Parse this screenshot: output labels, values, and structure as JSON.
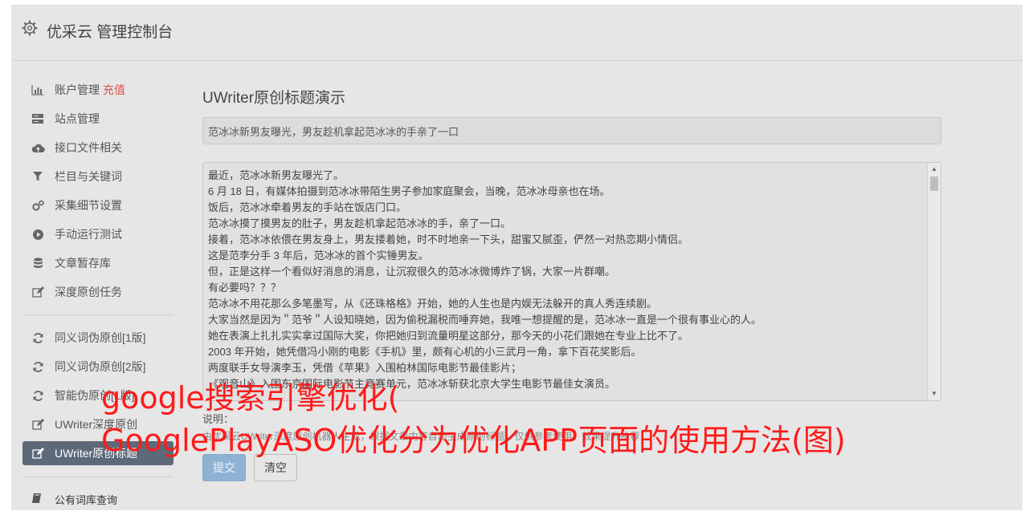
{
  "header": {
    "title": "优采云 管理控制台"
  },
  "sidebar": {
    "account": {
      "label": "账户管理",
      "recharge": "充值"
    },
    "group1": [
      {
        "label": "站点管理"
      },
      {
        "label": "接口文件相关"
      },
      {
        "label": "栏目与关键词"
      },
      {
        "label": "采集细节设置"
      },
      {
        "label": "手动运行测试"
      },
      {
        "label": "文章暂存库"
      },
      {
        "label": "深度原创任务"
      }
    ],
    "group2": [
      {
        "label": "同义词伪原创[1版]"
      },
      {
        "label": "同义词伪原创[2版]"
      },
      {
        "label": "智能伪原创[1版]"
      },
      {
        "label": "UWriter深度原创"
      },
      {
        "label": "UWriter原创标题"
      }
    ],
    "bottom": {
      "label": "公有词库查询"
    }
  },
  "main": {
    "heading": "UWriter原创标题演示",
    "title_value": "范冰冰新男友曝光，男友趁机拿起范冰冰的手亲了一口",
    "content_lines": [
      "最近，范冰冰新男友曝光了。",
      "6 月 18 日，有媒体拍摄到范冰冰带陌生男子参加家庭聚会，当晚，范冰冰母亲也在场。",
      "饭后，范冰冰牵着男友的手站在饭店门口。",
      "范冰冰摸了摸男友的肚子，男友趁机拿起范冰冰的手，亲了一口。",
      "接着，范冰冰依偎在男友身上，男友搂着她，时不时地亲一下头，甜蜜又腻歪，俨然一对热恋期小情侣。",
      "这是范李分手 3 年后，范冰冰的首个实锤男友。",
      "但，正是这样一个看似好消息的消息，让沉寂很久的范冰冰微博炸了锅，大家一片群嘲。",
      "有必要吗？？？",
      "范冰冰不用花那么多笔墨写，从《还珠格格》开始，她的人生也是内娱无法躲开的真人秀连续剧。",
      "大家当然是因为＂范爷＂人设知晓她，因为偷税漏税而唾弃她，我唯一想提醒的是，范冰冰一直是一个很有事业心的人。",
      "她在表演上扎扎实实拿过国际大奖，你把她归到流量明星这部分，那今天的小花们跟她在专业上比不了。",
      "2003 年开始，她凭借冯小刚的电影《手机》里，颇有心机的小三武月一角，拿下百花奖影后。",
      "两度联手女导演李玉，凭借《苹果》入围柏林国际电影节最佳影片；",
      "《观音山》入围东京国际电影节主竞赛单元，范冰冰斩获北京大学生电影节最佳女演员。"
    ],
    "notes_label": "说明：",
    "notes_desc": "由优采云UWriter深度原创机器人生成，根据文章内容自动生成原创标题，仅供参考使用，效果提升推荐……",
    "submit_label": "提交",
    "clear_label": "清空"
  },
  "overlay": {
    "line1": "google搜索引擎优化(",
    "line2": "GooglePlayASO优化分为优化APP页面的使用方法(图)"
  },
  "colors": {
    "overlay_text": "#ff1a1a",
    "recharge": "#d9534f",
    "active_item_bg": "#5d6978",
    "primary_button": "#8fb2d3"
  }
}
